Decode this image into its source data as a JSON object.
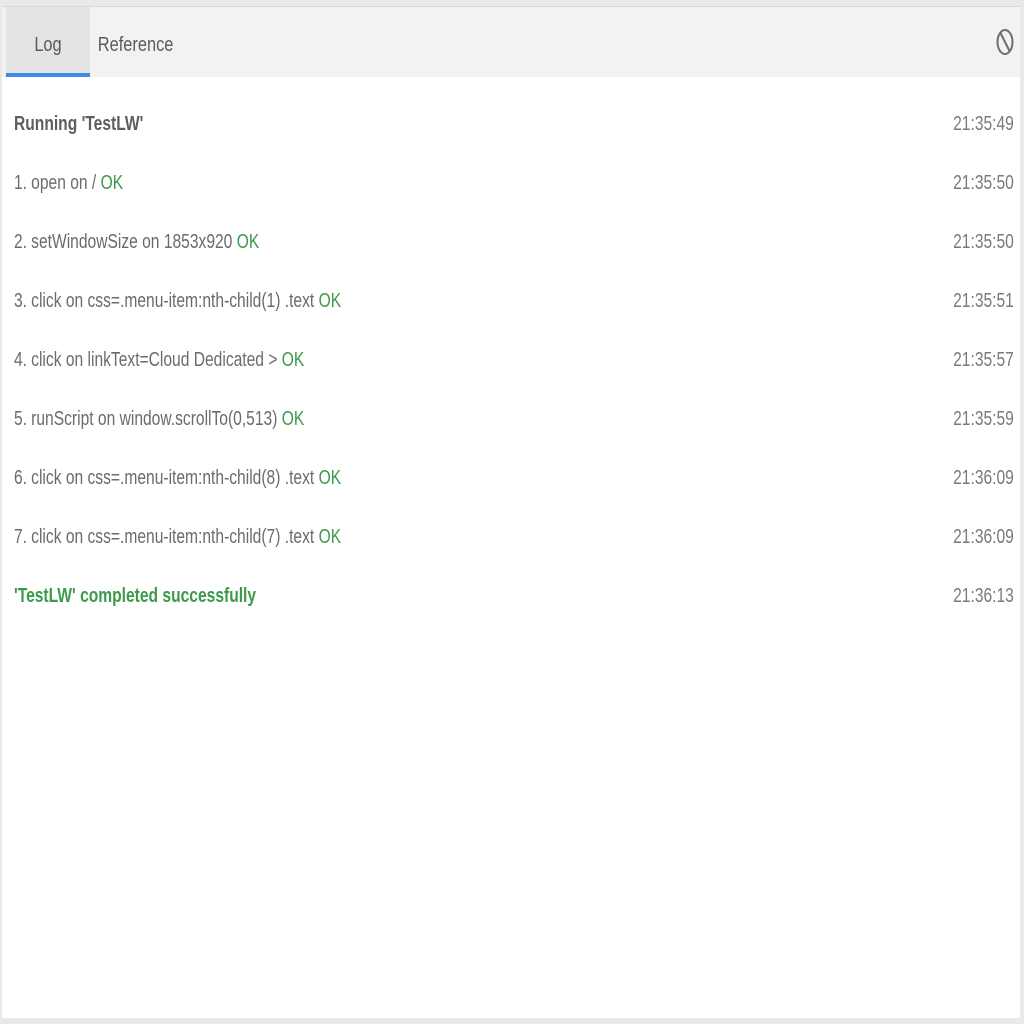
{
  "tabs": {
    "log": "Log",
    "reference": "Reference"
  },
  "icons": {
    "clear": "clear-log-icon"
  },
  "colors": {
    "accent": "#3b8ee8",
    "ok": "#3c9a4a",
    "text": "#6b6b6b"
  },
  "log": {
    "start": {
      "text": "Running 'TestLW'",
      "time": "21:35:49"
    },
    "steps": [
      {
        "num": "1.",
        "text": "open on /",
        "status": "OK",
        "time": "21:35:50"
      },
      {
        "num": "2.",
        "text": "setWindowSize on 1853x920",
        "status": "OK",
        "time": "21:35:50"
      },
      {
        "num": "3.",
        "text": "click on css=.menu-item:nth-child(1) .text",
        "status": "OK",
        "time": "21:35:51"
      },
      {
        "num": "4.",
        "text": "click on linkText=Cloud Dedicated >",
        "status": "OK",
        "time": "21:35:57"
      },
      {
        "num": "5.",
        "text": "runScript on window.scrollTo(0,513)",
        "status": "OK",
        "time": "21:35:59"
      },
      {
        "num": "6.",
        "text": "click on css=.menu-item:nth-child(8) .text",
        "status": "OK",
        "time": "21:36:09"
      },
      {
        "num": "7.",
        "text": "click on css=.menu-item:nth-child(7) .text",
        "status": "OK",
        "time": "21:36:09"
      }
    ],
    "end": {
      "text": "'TestLW' completed successfully",
      "time": "21:36:13"
    }
  }
}
